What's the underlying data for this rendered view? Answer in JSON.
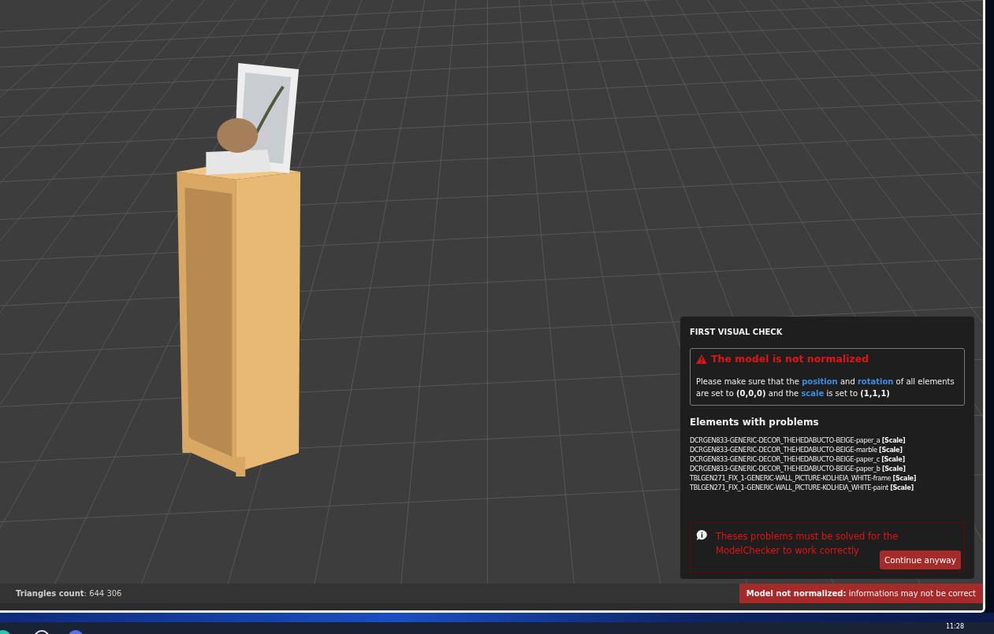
{
  "check_panel": {
    "title": "FIRST VISUAL CHECK",
    "alert": {
      "title": "The model is not normalized",
      "message": [
        {
          "text": "Please make sure that the ",
          "kind": "plain"
        },
        {
          "text": "position",
          "kind": "highlight"
        },
        {
          "text": " and ",
          "kind": "plain"
        },
        {
          "text": "rotation",
          "kind": "highlight"
        },
        {
          "text": " of all elements are set to ",
          "kind": "plain"
        },
        {
          "text": "(0,0,0)",
          "kind": "bold"
        },
        {
          "text": " and the ",
          "kind": "plain"
        },
        {
          "text": "scale",
          "kind": "highlight"
        },
        {
          "text": " is set to ",
          "kind": "plain"
        },
        {
          "text": "(1,1,1)",
          "kind": "bold"
        }
      ]
    },
    "problems_heading": "Elements with problems",
    "problems": [
      {
        "name": "DCRGEN833-GENERIC-DECOR_THEHEDABUCTO-BEIGE-paper_a",
        "tag": "[Scale]"
      },
      {
        "name": "DCRGEN833-GENERIC-DECOR_THEHEDABUCTO-BEIGE-marble",
        "tag": "[Scale]"
      },
      {
        "name": "DCRGEN833-GENERIC-DECOR_THEHEDABUCTO-BEIGE-paper_c",
        "tag": "[Scale]"
      },
      {
        "name": "DCRGEN833-GENERIC-DECOR_THEHEDABUCTO-BEIGE-paper_b",
        "tag": "[Scale]"
      },
      {
        "name": "TBLGEN271_FIX_1-GENERIC-WALL_PICTURE-KOLHEIA_WHITE-frame",
        "tag": "[Scale]"
      },
      {
        "name": "TBLGEN271_FIX_1-GENERIC-WALL_PICTURE-KOLHEIA_WHITE-paint",
        "tag": "[Scale]"
      }
    ],
    "warning": {
      "message": "Theses problems must be solved for the ModelChecker to work correctly",
      "button": "Continue anyway"
    }
  },
  "status_bar": {
    "triangles": "**Triangles count**: 644 306",
    "badge": "**Model not normalized:** informations may not be correct"
  },
  "taskbar": {
    "clock": "11:28"
  }
}
